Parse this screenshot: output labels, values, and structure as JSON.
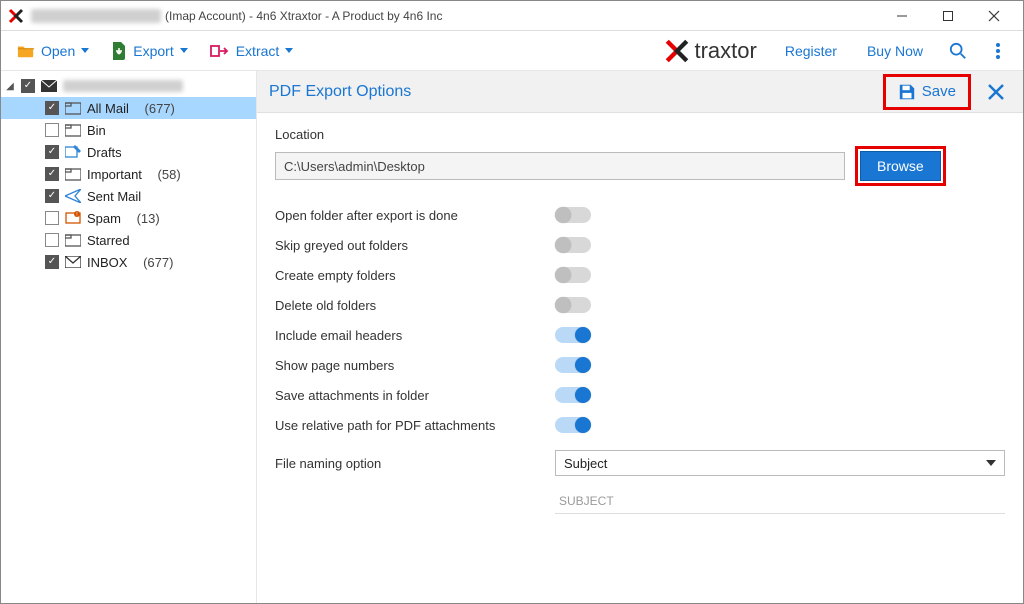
{
  "titlebar": {
    "suffix": "(Imap Account) - 4n6 Xtraxtor - A Product by 4n6 Inc"
  },
  "toolbar": {
    "open": "Open",
    "export": "Export",
    "extract": "Extract",
    "brand_text": "traxtor",
    "register": "Register",
    "buy": "Buy Now"
  },
  "sidebar": {
    "items": [
      {
        "label": "All Mail",
        "count": "(677)",
        "checked": true,
        "selected": true,
        "icon": "folder"
      },
      {
        "label": "Bin",
        "count": "",
        "checked": false,
        "selected": false,
        "icon": "folder"
      },
      {
        "label": "Drafts",
        "count": "",
        "checked": true,
        "selected": false,
        "icon": "drafts"
      },
      {
        "label": "Important",
        "count": "(58)",
        "checked": true,
        "selected": false,
        "icon": "folder"
      },
      {
        "label": "Sent Mail",
        "count": "",
        "checked": true,
        "selected": false,
        "icon": "sent"
      },
      {
        "label": "Spam",
        "count": "(13)",
        "checked": false,
        "selected": false,
        "icon": "spam"
      },
      {
        "label": "Starred",
        "count": "",
        "checked": false,
        "selected": false,
        "icon": "folder"
      },
      {
        "label": "INBOX",
        "count": "(677)",
        "checked": true,
        "selected": false,
        "icon": "inbox"
      }
    ]
  },
  "panel": {
    "title": "PDF Export Options",
    "save": "Save",
    "location_label": "Location",
    "location_value": "C:\\Users\\admin\\Desktop",
    "browse": "Browse",
    "options": [
      {
        "label": "Open folder after export is done",
        "on": false
      },
      {
        "label": "Skip greyed out folders",
        "on": false
      },
      {
        "label": "Create empty folders",
        "on": false
      },
      {
        "label": "Delete old folders",
        "on": false
      },
      {
        "label": "Include email headers",
        "on": true
      },
      {
        "label": "Show page numbers",
        "on": true
      },
      {
        "label": "Save attachments in folder",
        "on": true
      },
      {
        "label": "Use relative path for PDF attachments",
        "on": true
      }
    ],
    "naming_label": "File naming option",
    "naming_value": "Subject",
    "naming_preview": "SUBJECT"
  }
}
